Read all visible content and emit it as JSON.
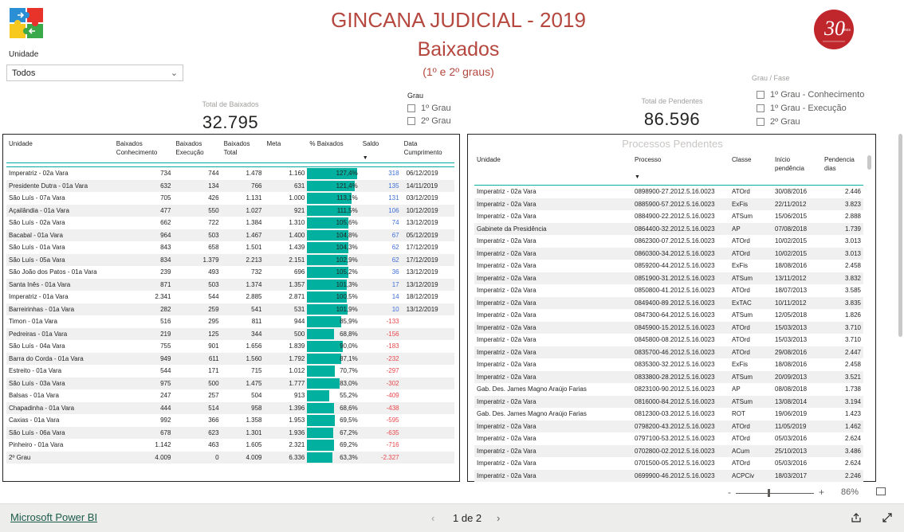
{
  "header": {
    "title": "GINCANA JUDICIAL - 2019",
    "subtitle": "Baixados",
    "subtitle2": "(1º e 2º graus)"
  },
  "unit_filter": {
    "label": "Unidade",
    "value": "Todos"
  },
  "kpis": {
    "baixados_label": "Total de Baixados",
    "baixados_value": "32.795",
    "pendentes_label": "Total de Pendentes",
    "pendentes_value": "86.596"
  },
  "grau_filter": {
    "title": "Grau",
    "options": [
      "1º Grau",
      "2º Grau"
    ]
  },
  "fase_filter": {
    "title": "Grau / Fase",
    "options": [
      "1º Grau - Conhecimento",
      "1º Grau - Execução",
      "2º Grau"
    ]
  },
  "left_table": {
    "headers": [
      "Unidade",
      "Baixados Conhecimento",
      "Baixados Execução",
      "Baixados Total",
      "Meta",
      "% Baixados",
      "Saldo",
      "Data Cumprimento"
    ],
    "rows": [
      [
        "Imperatriz - 02a Vara",
        "734",
        "744",
        "1.478",
        "1.160",
        "127,4%",
        "318",
        "06/12/2019"
      ],
      [
        "Presidente Dutra - 01a Vara",
        "632",
        "134",
        "766",
        "631",
        "121,4%",
        "135",
        "14/11/2019"
      ],
      [
        "São Luís - 07a Vara",
        "705",
        "426",
        "1.131",
        "1.000",
        "113,1%",
        "131",
        "03/12/2019"
      ],
      [
        "Açailândia - 01a Vara",
        "477",
        "550",
        "1.027",
        "921",
        "111,5%",
        "106",
        "10/12/2019"
      ],
      [
        "São Luís - 02a Vara",
        "662",
        "722",
        "1.384",
        "1.310",
        "105,6%",
        "74",
        "13/12/2019"
      ],
      [
        "Bacabal - 01a Vara",
        "964",
        "503",
        "1.467",
        "1.400",
        "104,8%",
        "67",
        "05/12/2019"
      ],
      [
        "São Luís - 01a Vara",
        "843",
        "658",
        "1.501",
        "1.439",
        "104,3%",
        "62",
        "17/12/2019"
      ],
      [
        "São Luís - 05a Vara",
        "834",
        "1.379",
        "2.213",
        "2.151",
        "102,9%",
        "62",
        "17/12/2019"
      ],
      [
        "São João dos Patos - 01a Vara",
        "239",
        "493",
        "732",
        "696",
        "105,2%",
        "36",
        "13/12/2019"
      ],
      [
        "Santa Inês - 01a Vara",
        "871",
        "503",
        "1.374",
        "1.357",
        "101,3%",
        "17",
        "13/12/2019"
      ],
      [
        "Imperatriz - 01a Vara",
        "2.341",
        "544",
        "2.885",
        "2.871",
        "100,5%",
        "14",
        "18/12/2019"
      ],
      [
        "Barreirinhas - 01a Vara",
        "282",
        "259",
        "541",
        "531",
        "101,9%",
        "10",
        "13/12/2019"
      ],
      [
        "Timon - 01a Vara",
        "516",
        "295",
        "811",
        "944",
        "85,9%",
        "-133",
        ""
      ],
      [
        "Pedreiras - 01a Vara",
        "219",
        "125",
        "344",
        "500",
        "68,8%",
        "-156",
        ""
      ],
      [
        "São Luís - 04a Vara",
        "755",
        "901",
        "1.656",
        "1.839",
        "90,0%",
        "-183",
        ""
      ],
      [
        "Barra do Corda - 01a Vara",
        "949",
        "611",
        "1.560",
        "1.792",
        "87,1%",
        "-232",
        ""
      ],
      [
        "Estreito - 01a Vara",
        "544",
        "171",
        "715",
        "1.012",
        "70,7%",
        "-297",
        ""
      ],
      [
        "São Luís - 03a Vara",
        "975",
        "500",
        "1.475",
        "1.777",
        "83,0%",
        "-302",
        ""
      ],
      [
        "Balsas - 01a Vara",
        "247",
        "257",
        "504",
        "913",
        "55,2%",
        "-409",
        ""
      ],
      [
        "Chapadinha - 01a Vara",
        "444",
        "514",
        "958",
        "1.396",
        "68,6%",
        "-438",
        ""
      ],
      [
        "Caxias - 01a Vara",
        "992",
        "366",
        "1.358",
        "1.953",
        "69,5%",
        "-595",
        ""
      ],
      [
        "São Luís - 06a Vara",
        "678",
        "623",
        "1.301",
        "1.936",
        "67,2%",
        "-635",
        ""
      ],
      [
        "Pinheiro - 01a Vara",
        "1.142",
        "463",
        "1.605",
        "2.321",
        "69,2%",
        "-716",
        ""
      ],
      [
        "2º Grau",
        "4.009",
        "0",
        "4.009",
        "6.336",
        "63,3%",
        "-2.327",
        ""
      ]
    ],
    "pct_values": [
      127.4,
      121.4,
      113.1,
      111.5,
      105.6,
      104.8,
      104.3,
      102.9,
      105.2,
      101.3,
      100.5,
      101.9,
      85.9,
      68.8,
      90.0,
      87.1,
      70.7,
      83.0,
      55.2,
      68.6,
      69.5,
      67.2,
      69.2,
      63.3
    ]
  },
  "right_table": {
    "title": "Processos Pendentes",
    "headers": [
      "Unidade",
      "Processo",
      "Classe",
      "Início pendência",
      "Pendencia dias"
    ],
    "rows": [
      [
        "Imperatriz - 02a Vara",
        "0898900-27.2012.5.16.0023",
        "ATOrd",
        "30/08/2016",
        "2.446"
      ],
      [
        "Imperatriz - 02a Vara",
        "0885900-57.2012.5.16.0023",
        "ExFis",
        "22/11/2012",
        "3.823"
      ],
      [
        "Imperatriz - 02a Vara",
        "0884900-22.2012.5.16.0023",
        "ATSum",
        "15/06/2015",
        "2.888"
      ],
      [
        "Gabinete da Presidência",
        "0864400-32.2012.5.16.0023",
        "AP",
        "07/08/2018",
        "1.739"
      ],
      [
        "Imperatriz - 02a Vara",
        "0862300-07.2012.5.16.0023",
        "ATOrd",
        "10/02/2015",
        "3.013"
      ],
      [
        "Imperatriz - 02a Vara",
        "0860300-34.2012.5.16.0023",
        "ATOrd",
        "10/02/2015",
        "3.013"
      ],
      [
        "Imperatriz - 02a Vara",
        "0859200-44.2012.5.16.0023",
        "ExFis",
        "18/08/2016",
        "2.458"
      ],
      [
        "Imperatriz - 02a Vara",
        "0851900-31.2012.5.16.0023",
        "ATSum",
        "13/11/2012",
        "3.832"
      ],
      [
        "Imperatriz - 02a Vara",
        "0850800-41.2012.5.16.0023",
        "ATOrd",
        "18/07/2013",
        "3.585"
      ],
      [
        "Imperatriz - 02a Vara",
        "0849400-89.2012.5.16.0023",
        "ExTAC",
        "10/11/2012",
        "3.835"
      ],
      [
        "Imperatriz - 02a Vara",
        "0847300-64.2012.5.16.0023",
        "ATSum",
        "12/05/2018",
        "1.826"
      ],
      [
        "Imperatriz - 02a Vara",
        "0845900-15.2012.5.16.0023",
        "ATOrd",
        "15/03/2013",
        "3.710"
      ],
      [
        "Imperatriz - 02a Vara",
        "0845800-08.2012.5.16.0023",
        "ATOrd",
        "15/03/2013",
        "3.710"
      ],
      [
        "Imperatriz - 02a Vara",
        "0835700-46.2012.5.16.0023",
        "ATOrd",
        "29/08/2016",
        "2.447"
      ],
      [
        "Imperatriz - 02a Vara",
        "0835300-32.2012.5.16.0023",
        "ExFis",
        "18/08/2016",
        "2.458"
      ],
      [
        "Imperatriz - 02a Vara",
        "0833800-28.2012.5.16.0023",
        "ATSum",
        "20/09/2013",
        "3.521"
      ],
      [
        "Gab. Des. James Magno Araújo Farias",
        "0823100-90.2012.5.16.0023",
        "AP",
        "08/08/2018",
        "1.738"
      ],
      [
        "Imperatriz - 02a Vara",
        "0816000-84.2012.5.16.0023",
        "ATSum",
        "13/08/2014",
        "3.194"
      ],
      [
        "Gab. Des. James Magno Araújo Farias",
        "0812300-03.2012.5.16.0023",
        "ROT",
        "19/06/2019",
        "1.423"
      ],
      [
        "Imperatriz - 02a Vara",
        "0798200-43.2012.5.16.0023",
        "ATOrd",
        "11/05/2019",
        "1.462"
      ],
      [
        "Imperatriz - 02a Vara",
        "0797100-53.2012.5.16.0023",
        "ATOrd",
        "05/03/2016",
        "2.624"
      ],
      [
        "Imperatriz - 02a Vara",
        "0702800-02.2012.5.16.0023",
        "ACum",
        "25/10/2013",
        "3.486"
      ],
      [
        "Imperatriz - 02a Vara",
        "0701500-05.2012.5.16.0023",
        "ATOrd",
        "05/03/2016",
        "2.624"
      ],
      [
        "Imperatriz - 02a Vara",
        "0699900-46.2012.5.16.0023",
        "ACPCiv",
        "18/03/2017",
        "2.246"
      ]
    ]
  },
  "footer": {
    "brand": "Microsoft Power BI",
    "page": "1 de 2",
    "zoom": "86%"
  },
  "colors": {
    "accent": "#02b0a0",
    "title": "#b5473f",
    "positive": "#3f6fd6",
    "negative": "#e8474d"
  }
}
